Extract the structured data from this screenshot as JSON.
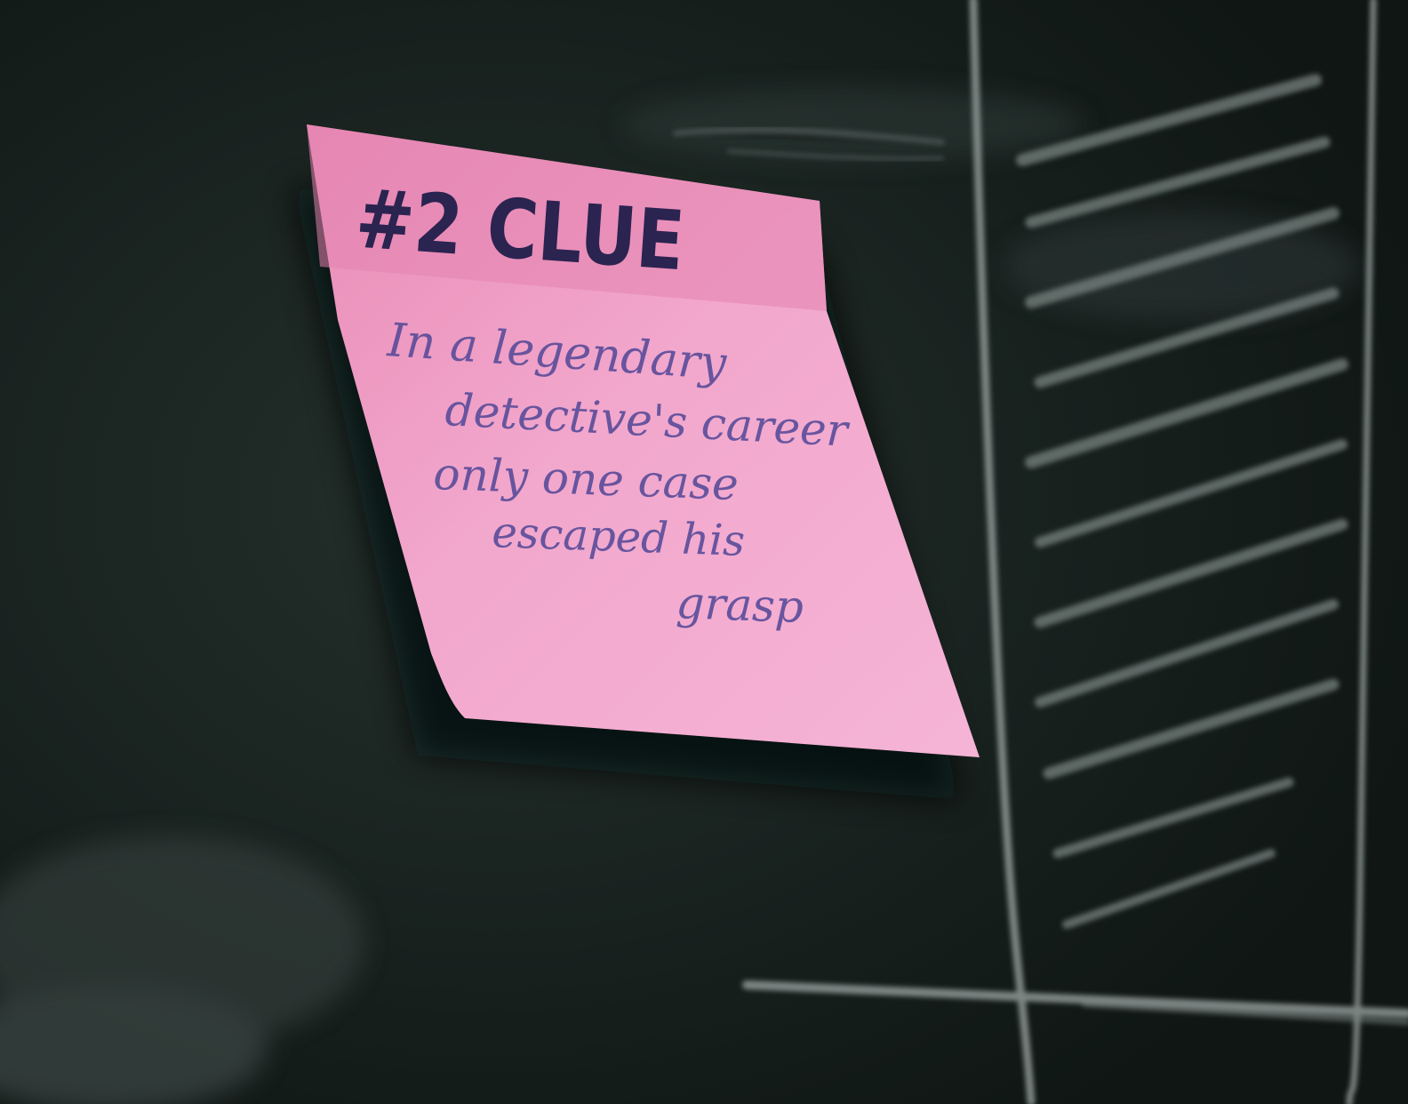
{
  "note": {
    "heading": "#2 CLUE",
    "lines": [
      "In a legendary",
      "detective's career",
      "only one case",
      "escaped his",
      "grasp"
    ]
  },
  "colors": {
    "chalkboard": "#1a2320",
    "note_pink": "#ef9ec4",
    "ink_heading": "#2b2350",
    "ink_body": "#5a4c9a",
    "chalk": "#a7b0ae"
  }
}
